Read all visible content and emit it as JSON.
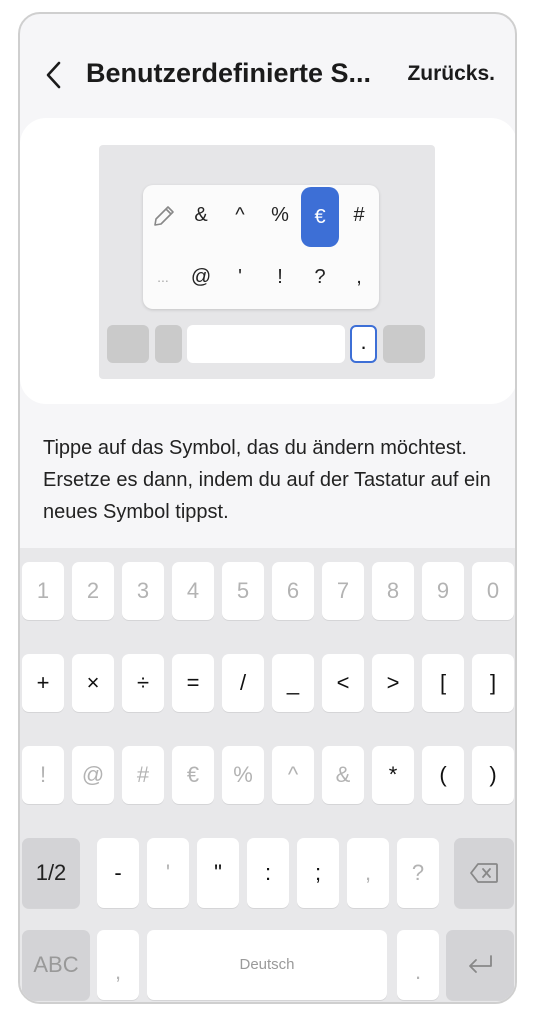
{
  "header": {
    "title": "Benutzerdefinierte S...",
    "reset_label": "Zurücks."
  },
  "preview": {
    "symbols_row1": [
      "&",
      "^",
      "%",
      "€",
      "#"
    ],
    "symbols_row2": [
      "@",
      "'",
      "!",
      "?",
      ","
    ],
    "ellipsis": "...",
    "selected_symbol": "€",
    "period_key": "."
  },
  "description": "Tippe auf das Symbol, das du ändern möchtest. Ersetze es dann, indem du auf der Tastatur auf ein neues Symbol tippst.",
  "keyboard": {
    "row_numbers": [
      "1",
      "2",
      "3",
      "4",
      "5",
      "6",
      "7",
      "8",
      "9",
      "0"
    ],
    "row_symbols1": [
      "+",
      "×",
      "÷",
      "=",
      "/",
      "_",
      "<",
      ">",
      "[",
      "]"
    ],
    "row_symbols2": [
      "!",
      "@",
      "#",
      "€",
      "%",
      "^",
      "&",
      "*",
      "(",
      ")"
    ],
    "row_symbols3": [
      "-",
      "'",
      "\"",
      ":",
      ";",
      ",",
      "?"
    ],
    "page_toggle": "1/2",
    "abc_label": "ABC",
    "comma": ",",
    "space_label": "Deutsch",
    "period": "."
  },
  "colors": {
    "accent": "#3d6fd6",
    "key_bg": "#ffffff",
    "fn_key_bg": "#d3d3d6"
  }
}
